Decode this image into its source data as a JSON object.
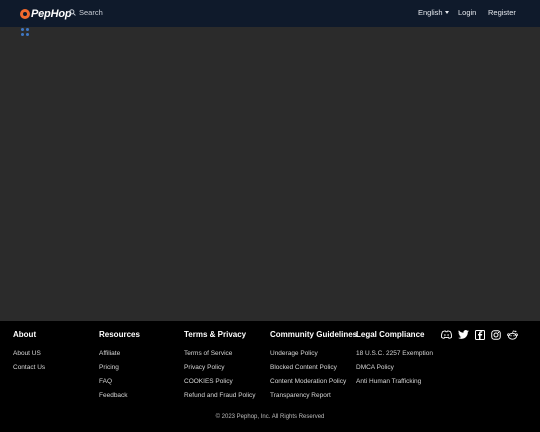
{
  "header": {
    "logo_text": "PepHop",
    "search_label": "Search",
    "language": "English",
    "login": "Login",
    "register": "Register",
    "colors": {
      "bar": "#0f1a2b",
      "brand": "#f26a2e"
    }
  },
  "loader": {
    "icon": "loading-dots-icon",
    "color": "#3f78c4"
  },
  "footer": {
    "columns": [
      {
        "title": "About",
        "links": [
          "About US",
          "Contact Us"
        ]
      },
      {
        "title": "Resources",
        "links": [
          "Affiliate",
          "Pricing",
          "FAQ",
          "Feedback"
        ]
      },
      {
        "title": "Terms & Privacy",
        "links": [
          "Terms of Service",
          "Privacy Policy",
          "COOKIES Policy",
          "Refund and Fraud Policy"
        ]
      },
      {
        "title": "Community Guidelines",
        "links": [
          "Underage Policy",
          "Blocked Content Policy",
          "Content Moderation Policy",
          "Transparency Report"
        ]
      },
      {
        "title": "Legal Compliance",
        "links": [
          "18 U.S.C. 2257 Exemption",
          "DMCA Policy",
          "Anti Human Trafficking"
        ]
      }
    ],
    "social": [
      "discord-icon",
      "twitter-icon",
      "facebook-icon",
      "instagram-icon",
      "reddit-icon"
    ],
    "copyright": "© 2023 Pephop, Inc. All Rights Reserved"
  }
}
